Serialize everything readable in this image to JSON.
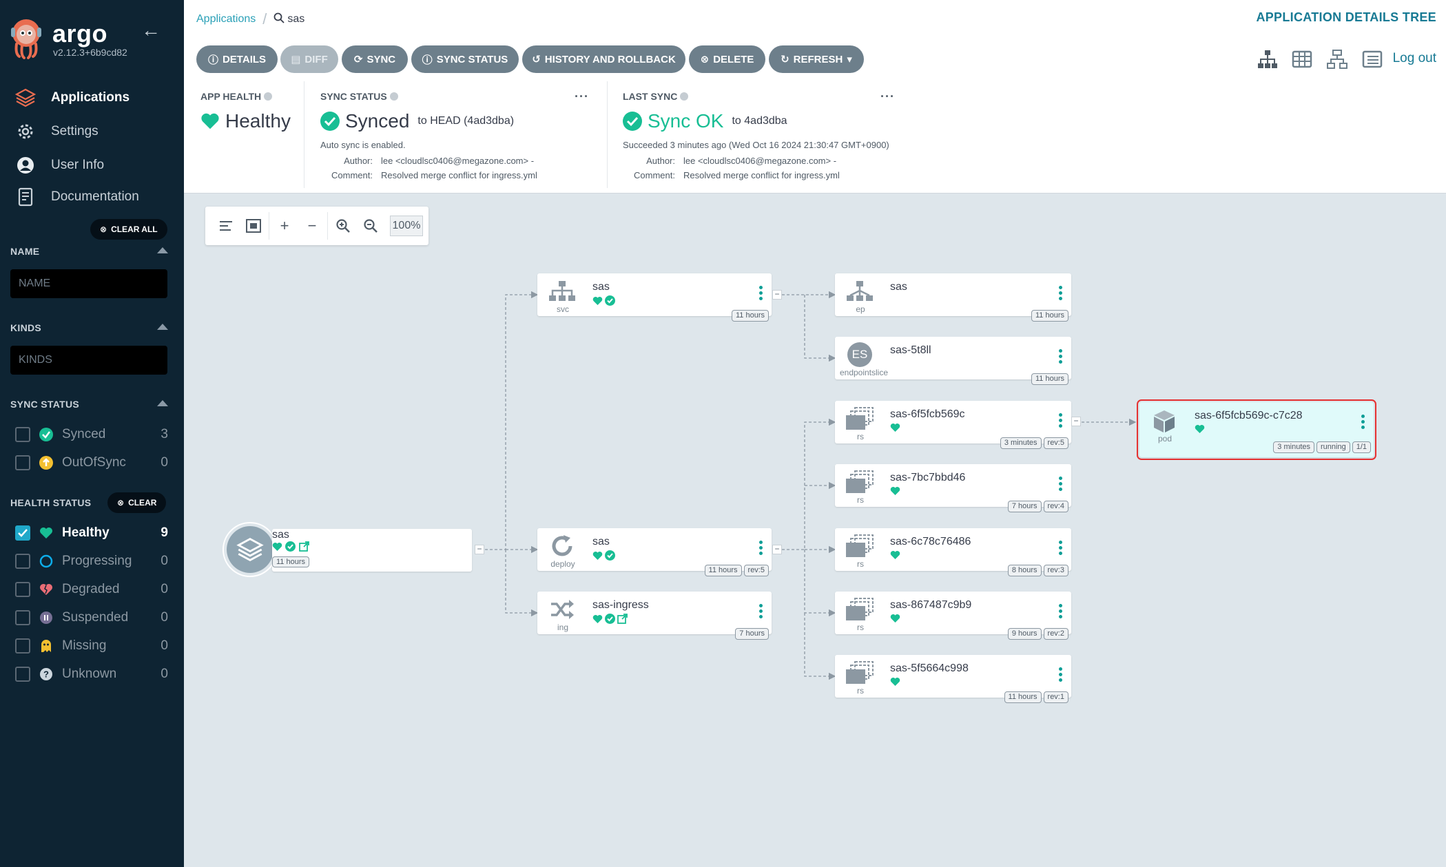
{
  "sidebar": {
    "brand": "argo",
    "version": "v2.12.3+6b9cd82",
    "nav": [
      {
        "label": "Applications",
        "icon": "layers-icon",
        "active": true
      },
      {
        "label": "Settings",
        "icon": "gear-icon"
      },
      {
        "label": "User Info",
        "icon": "user-icon"
      },
      {
        "label": "Documentation",
        "icon": "book-icon"
      }
    ],
    "clear_all": "CLEAR ALL",
    "name_filter": {
      "title": "NAME",
      "placeholder": "NAME"
    },
    "kinds_filter": {
      "title": "KINDS",
      "placeholder": "KINDS"
    },
    "sync_status": {
      "title": "SYNC STATUS",
      "items": [
        {
          "label": "Synced",
          "count": "3"
        },
        {
          "label": "OutOfSync",
          "count": "0"
        }
      ]
    },
    "health_status": {
      "title": "HEALTH STATUS",
      "clear": "CLEAR",
      "items": [
        {
          "label": "Healthy",
          "count": "9",
          "checked": true
        },
        {
          "label": "Progressing",
          "count": "0"
        },
        {
          "label": "Degraded",
          "count": "0"
        },
        {
          "label": "Suspended",
          "count": "0"
        },
        {
          "label": "Missing",
          "count": "0"
        },
        {
          "label": "Unknown",
          "count": "0"
        }
      ]
    }
  },
  "topbar": {
    "breadcrumb_root": "Applications",
    "breadcrumb_current": "sas",
    "page_title": "APPLICATION DETAILS TREE",
    "buttons": {
      "details": "DETAILS",
      "diff": "DIFF",
      "sync": "SYNC",
      "sync_status": "SYNC STATUS",
      "history": "HISTORY AND ROLLBACK",
      "delete": "DELETE",
      "refresh": "REFRESH"
    },
    "logout": "Log out"
  },
  "status": {
    "app_health": {
      "title": "APP HEALTH",
      "value": "Healthy"
    },
    "sync_status": {
      "title": "SYNC STATUS",
      "value": "Synced",
      "target": "to HEAD (4ad3dba)",
      "auto_sync": "Auto sync is enabled.",
      "author_label": "Author:",
      "author": "lee <cloudlsc0406@megazone.com> -",
      "comment_label": "Comment:",
      "comment": "Resolved merge conflict for ingress.yml"
    },
    "last_sync": {
      "title": "LAST SYNC",
      "value": "Sync OK",
      "target": "to 4ad3dba",
      "succeeded": "Succeeded 3 minutes ago (Wed Oct 16 2024 21:30:47 GMT+0900)",
      "author_label": "Author:",
      "author": "lee <cloudlsc0406@megazone.com> -",
      "comment_label": "Comment:",
      "comment": "Resolved merge conflict for ingress.yml"
    }
  },
  "graph_toolbar": {
    "zoom": "100%"
  },
  "nodes": {
    "app": {
      "name": "sas",
      "age": "11 hours"
    },
    "svc": {
      "name": "sas",
      "kind": "svc",
      "age": "11 hours"
    },
    "ep": {
      "name": "sas",
      "kind": "ep",
      "age": "11 hours"
    },
    "es": {
      "name": "sas-5t8ll",
      "kind": "endpointslice",
      "badge": "ES",
      "age": "11 hours"
    },
    "deploy": {
      "name": "sas",
      "kind": "deploy",
      "age": "11 hours",
      "rev": "rev:5"
    },
    "ing": {
      "name": "sas-ingress",
      "kind": "ing",
      "age": "7 hours"
    },
    "rs1": {
      "name": "sas-6f5fcb569c",
      "kind": "rs",
      "age": "3 minutes",
      "rev": "rev:5"
    },
    "rs2": {
      "name": "sas-7bc7bbd46",
      "kind": "rs",
      "age": "7 hours",
      "rev": "rev:4"
    },
    "rs3": {
      "name": "sas-6c78c76486",
      "kind": "rs",
      "age": "8 hours",
      "rev": "rev:3"
    },
    "rs4": {
      "name": "sas-867487c9b9",
      "kind": "rs",
      "age": "9 hours",
      "rev": "rev:2"
    },
    "rs5": {
      "name": "sas-5f5664c998",
      "kind": "rs",
      "age": "11 hours",
      "rev": "rev:1"
    },
    "pod": {
      "name": "sas-6f5fcb569c-c7c28",
      "kind": "pod",
      "age": "3 minutes",
      "state": "running",
      "ready": "1/1"
    }
  },
  "colors": {
    "accent": "#18be94",
    "sidebar": "#0e2433",
    "highlight": "#e53030",
    "link": "#177a94"
  }
}
